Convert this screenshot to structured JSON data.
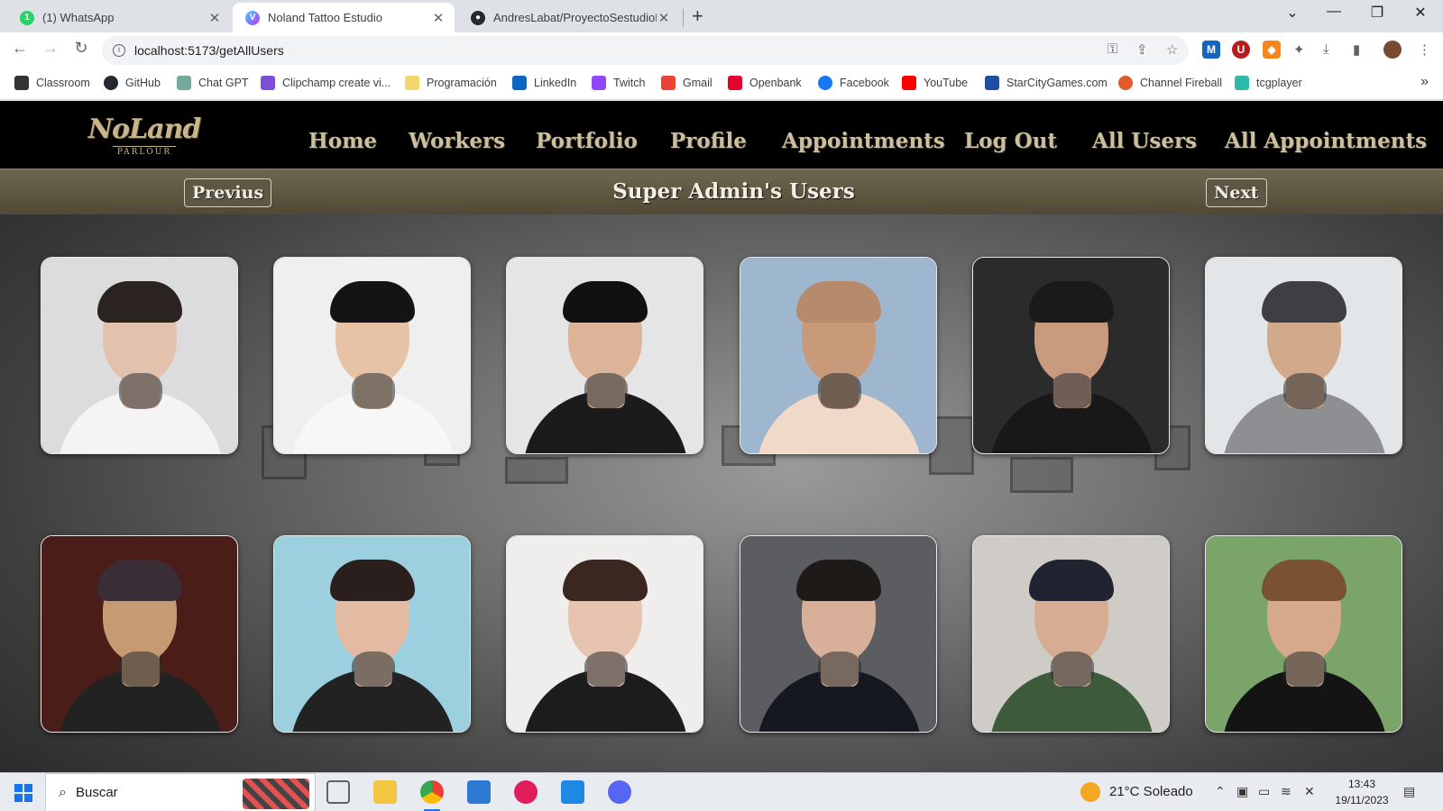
{
  "browser": {
    "tabs": [
      {
        "title": "(1) WhatsApp",
        "favicon": "whatsapp-icon",
        "color": "#25d366",
        "glyph": "1"
      },
      {
        "title": "Noland Tattoo Estudio",
        "favicon": "vite-icon",
        "color": "#8a6cff",
        "glyph": "V"
      },
      {
        "title": "AndresLabat/ProyectoSestudioD",
        "favicon": "github-icon",
        "color": "#24292f",
        "glyph": "●"
      }
    ],
    "url": "localhost:5173/getAllUsers",
    "bookmarks": [
      {
        "label": "Classroom",
        "icon": "classroom-icon",
        "color": "#333333"
      },
      {
        "label": "GitHub",
        "icon": "github-icon",
        "color": "#24292f"
      },
      {
        "label": "Chat GPT",
        "icon": "chatgpt-icon",
        "color": "#74aa9c"
      },
      {
        "label": "Clipchamp create vi...",
        "icon": "clipchamp-icon",
        "color": "#7b4fd6"
      },
      {
        "label": "Programación",
        "icon": "folder-icon",
        "color": "#f6d66b"
      },
      {
        "label": "LinkedIn",
        "icon": "linkedin-icon",
        "color": "#0a66c2"
      },
      {
        "label": "Twitch",
        "icon": "twitch-icon",
        "color": "#9146ff"
      },
      {
        "label": "Gmail",
        "icon": "gmail-icon",
        "color": "#ea4335"
      },
      {
        "label": "Openbank",
        "icon": "openbank-icon",
        "color": "#e4002b"
      },
      {
        "label": "Facebook",
        "icon": "facebook-icon",
        "color": "#1877f2"
      },
      {
        "label": "YouTube",
        "icon": "youtube-icon",
        "color": "#ff0000"
      },
      {
        "label": "StarCityGames.com",
        "icon": "starcity-icon",
        "color": "#1c4fa1"
      },
      {
        "label": "Channel Fireball",
        "icon": "channelfireball-icon",
        "color": "#e05a2b"
      },
      {
        "label": "tcgplayer",
        "icon": "tcgplayer-icon",
        "color": "#2eb8a8"
      }
    ]
  },
  "site": {
    "logo": {
      "main": "NoLand",
      "sub": "PARLOUR"
    },
    "nav": [
      "Home",
      "Workers",
      "Portfolio",
      "Profile",
      "Appointments",
      "Log Out",
      "All Users",
      "All Appointments"
    ],
    "pager": {
      "prev": "Previus",
      "title": "Super Admin's Users",
      "next": "Next"
    },
    "users": [
      {
        "photo": "user-photo",
        "bg": "#dcdcdc",
        "skin": "#e2c2ad",
        "hair": "#2a2320",
        "shirt": "#f4f4f4"
      },
      {
        "photo": "user-photo",
        "bg": "#efefef",
        "skin": "#e6c3a6",
        "hair": "#141414",
        "shirt": "#f7f7f7"
      },
      {
        "photo": "user-photo",
        "bg": "#e5e5e5",
        "skin": "#dcb49a",
        "hair": "#111111",
        "shirt": "#1b1b1b"
      },
      {
        "photo": "user-photo",
        "bg": "#9fb6cf",
        "skin": "#c99a7a",
        "hair": "#b88a6c",
        "shirt": "#f0d9c8"
      },
      {
        "photo": "user-photo",
        "bg": "#2b2b2b",
        "skin": "#c89a7e",
        "hair": "#1a1a1a",
        "shirt": "#181818"
      },
      {
        "photo": "user-photo",
        "bg": "#e3e6e8",
        "skin": "#d2a98a",
        "hair": "#3d3f42",
        "shirt": "#8d8f92"
      },
      {
        "photo": "user-photo",
        "bg": "#4a1d18",
        "skin": "#c69a72",
        "hair": "#3a2d36",
        "shirt": "#222222"
      },
      {
        "photo": "user-photo",
        "bg": "#9cd0de",
        "skin": "#e2bba2",
        "hair": "#2a1f1d",
        "shirt": "#222222"
      },
      {
        "photo": "user-photo",
        "bg": "#f0eeec",
        "skin": "#e6c4b0",
        "hair": "#3b2720",
        "shirt": "#1c1c1c"
      },
      {
        "photo": "user-photo",
        "bg": "#5b5d60",
        "skin": "#d8b09a",
        "hair": "#1e1a18",
        "shirt": "#151820"
      },
      {
        "photo": "user-photo",
        "bg": "#cfcbc6",
        "skin": "#d6ad92",
        "hair": "#1f2430",
        "shirt": "#3d5a3a"
      },
      {
        "photo": "user-photo",
        "bg": "#7aa46a",
        "skin": "#d6a98a",
        "hair": "#7a5232",
        "shirt": "#141414"
      }
    ]
  },
  "taskbar": {
    "search_placeholder": "Buscar",
    "weather": "21°C  Soleado",
    "time": "13:43",
    "date": "19/11/2023",
    "apps": [
      {
        "name": "task-view-icon",
        "color": "#5f6368"
      },
      {
        "name": "file-explorer-icon",
        "color": "#f4c542"
      },
      {
        "name": "chrome-icon",
        "color": "#ea4335"
      },
      {
        "name": "mail-icon",
        "color": "#2b79d3"
      },
      {
        "name": "slack-icon",
        "color": "#e01e5a"
      },
      {
        "name": "vscode-icon",
        "color": "#1e88e5"
      },
      {
        "name": "discord-icon",
        "color": "#5865f2"
      }
    ]
  }
}
